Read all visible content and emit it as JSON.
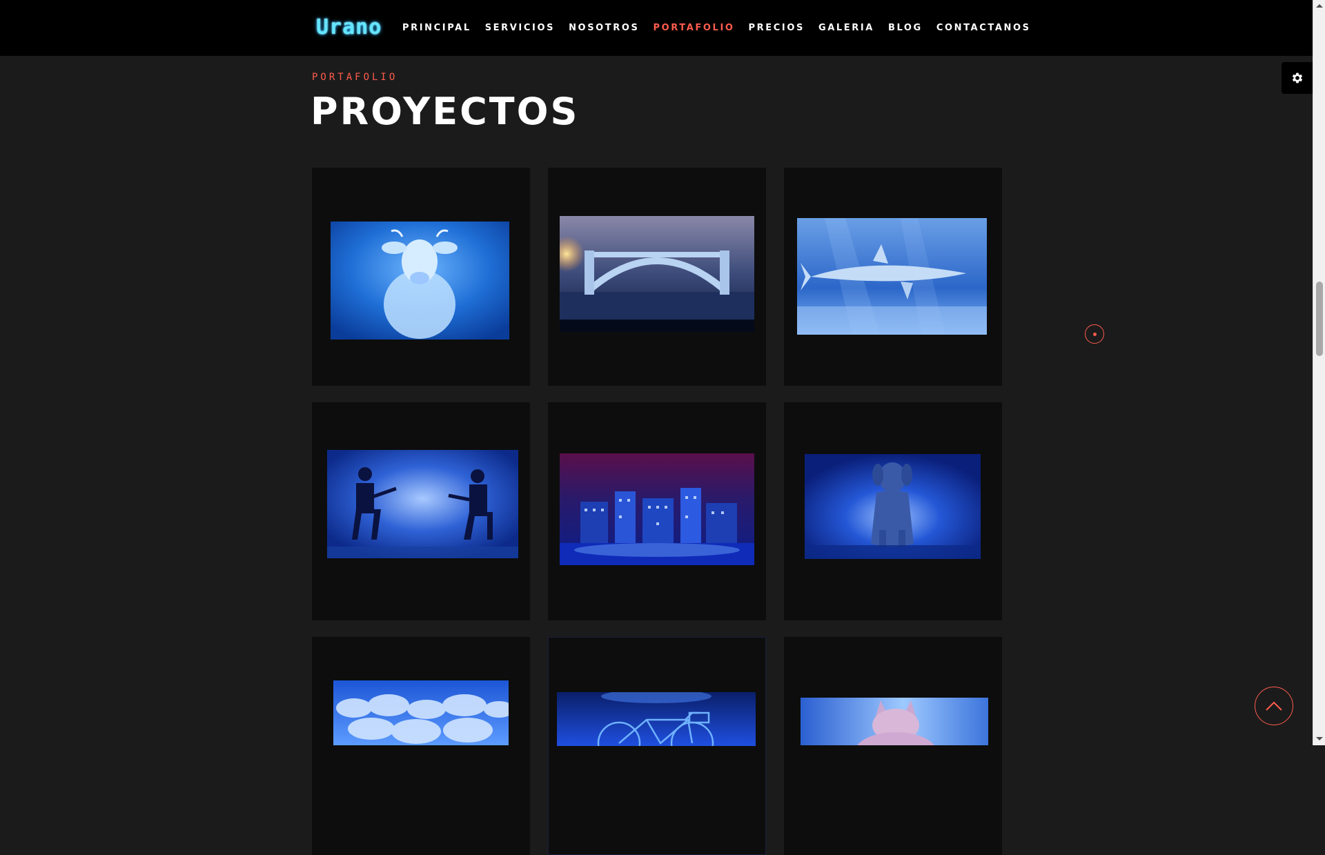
{
  "brand": {
    "logo_text": "Urano",
    "logo_color": "#63e6ff"
  },
  "nav": {
    "items": [
      {
        "label": "PRINCIPAL",
        "active": false
      },
      {
        "label": "SERVICIOS",
        "active": false
      },
      {
        "label": "NOSOTROS",
        "active": false
      },
      {
        "label": "PORTAFOLIO",
        "active": true
      },
      {
        "label": "PRECIOS",
        "active": false
      },
      {
        "label": "GALERIA",
        "active": false
      },
      {
        "label": "BLOG",
        "active": false
      },
      {
        "label": "CONTACTANOS",
        "active": false
      }
    ],
    "active_color": "#ff5c4d"
  },
  "portfolio": {
    "subtitle": "PORTAFOLIO",
    "title": "PROYECTOS",
    "items": [
      {
        "subject": "cow"
      },
      {
        "subject": "bridge"
      },
      {
        "subject": "shark"
      },
      {
        "subject": "guitarists"
      },
      {
        "subject": "city"
      },
      {
        "subject": "dog"
      },
      {
        "subject": "clouds"
      },
      {
        "subject": "bicycle"
      },
      {
        "subject": "cat"
      }
    ]
  },
  "icons": {
    "settings": "gear-icon",
    "back_to_top": "chevron-up-icon",
    "indicator": "dot-icon"
  },
  "colors": {
    "accent": "#ff5c4d",
    "background": "#1b1b1b",
    "navbar": "#000000",
    "card": "#0d0d0d"
  }
}
